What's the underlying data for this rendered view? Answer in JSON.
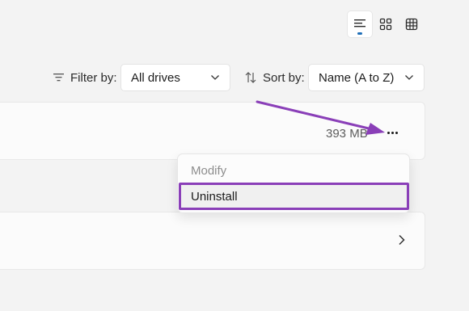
{
  "view_toggle": {
    "options": [
      {
        "icon": "list-view-icon",
        "active": true
      },
      {
        "icon": "grid-view-icon",
        "active": false
      },
      {
        "icon": "tile-view-icon",
        "active": false
      }
    ]
  },
  "filter": {
    "label": "Filter by:",
    "icon": "filter-icon",
    "value": "All drives"
  },
  "sort": {
    "label": "Sort by:",
    "icon": "sort-icon",
    "value": "Name (A to Z)"
  },
  "app_card": {
    "size": "393 MB",
    "more_icon": "more-options-icon"
  },
  "context_menu": {
    "items": [
      {
        "label": "Modify",
        "enabled": false
      },
      {
        "label": "Uninstall",
        "enabled": true,
        "highlighted": true
      }
    ]
  },
  "annotation": {
    "color": "#8a3fb8"
  },
  "second_card": {
    "icon": "chevron-right-icon"
  }
}
